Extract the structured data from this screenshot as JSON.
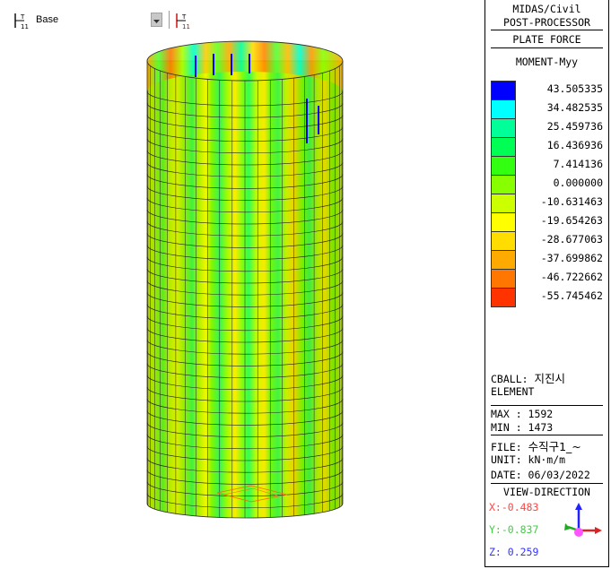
{
  "toolbar": {
    "story_label": "Base"
  },
  "panel": {
    "app_name": "MIDAS/Civil",
    "subtitle": "POST-PROCESSOR",
    "result_type": "PLATE FORCE",
    "component": "MOMENT-Myy",
    "legend": [
      {
        "value": "43.505335",
        "color": "#0000ff"
      },
      {
        "value": "34.482535",
        "color": "#00ffff"
      },
      {
        "value": "25.459736",
        "color": "#00ff99"
      },
      {
        "value": "16.436936",
        "color": "#00ff55"
      },
      {
        "value": "7.414136",
        "color": "#33ff11"
      },
      {
        "value": "0.000000",
        "color": "#88ff00"
      },
      {
        "value": "-10.631463",
        "color": "#ccff00"
      },
      {
        "value": "-19.654263",
        "color": "#ffff00"
      },
      {
        "value": "-28.677063",
        "color": "#ffdd00"
      },
      {
        "value": "-37.699862",
        "color": "#ffaa00"
      },
      {
        "value": "-46.722662",
        "color": "#ff7700"
      },
      {
        "value": "-55.745462",
        "color": "#ff3300"
      }
    ],
    "load_case_prefix": "CBALL:",
    "load_case_name": "지진시",
    "element_label": "ELEMENT",
    "max_line": "MAX : 1592",
    "min_line": "MIN : 1473",
    "file_prefix": "FILE:",
    "file_name": "수직구1_~",
    "unit_line": "UNIT: kN·m/m",
    "date_line": "DATE: 06/03/2022",
    "view_direction_label": "VIEW-DIRECTION",
    "view_x": "X:-0.483",
    "view_y": "Y:-0.837",
    "view_z": "Z: 0.259",
    "colors": {
      "x": "#ff4444",
      "y": "#44cc44",
      "z": "#3333ff"
    }
  }
}
